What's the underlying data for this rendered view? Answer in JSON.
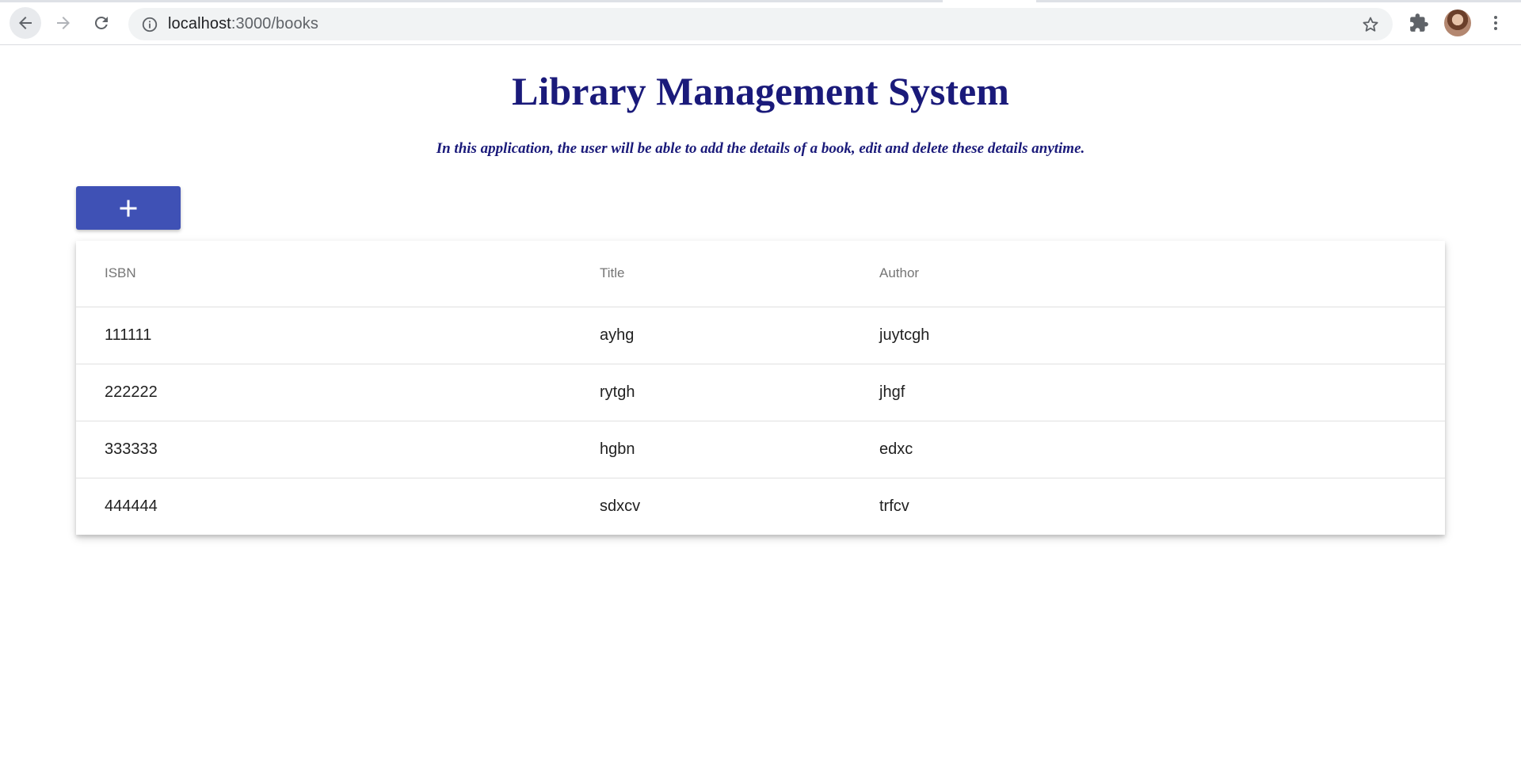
{
  "browser": {
    "url_host": "localhost",
    "url_path": ":3000/books"
  },
  "page": {
    "title": "Library Management System",
    "subtitle": "In this application, the user will be able to add the details of a book, edit and delete these details anytime.",
    "add_button_icon": "plus-icon",
    "accent_color": "#3f51b5",
    "heading_color": "#1a1a7a"
  },
  "table": {
    "columns": [
      "ISBN",
      "Title",
      "Author"
    ],
    "rows": [
      {
        "isbn": "111111",
        "title": "ayhg",
        "author": "juytcgh"
      },
      {
        "isbn": "222222",
        "title": "rytgh",
        "author": "jhgf"
      },
      {
        "isbn": "333333",
        "title": "hgbn",
        "author": "edxc"
      },
      {
        "isbn": "444444",
        "title": "sdxcv",
        "author": "trfcv"
      }
    ]
  }
}
